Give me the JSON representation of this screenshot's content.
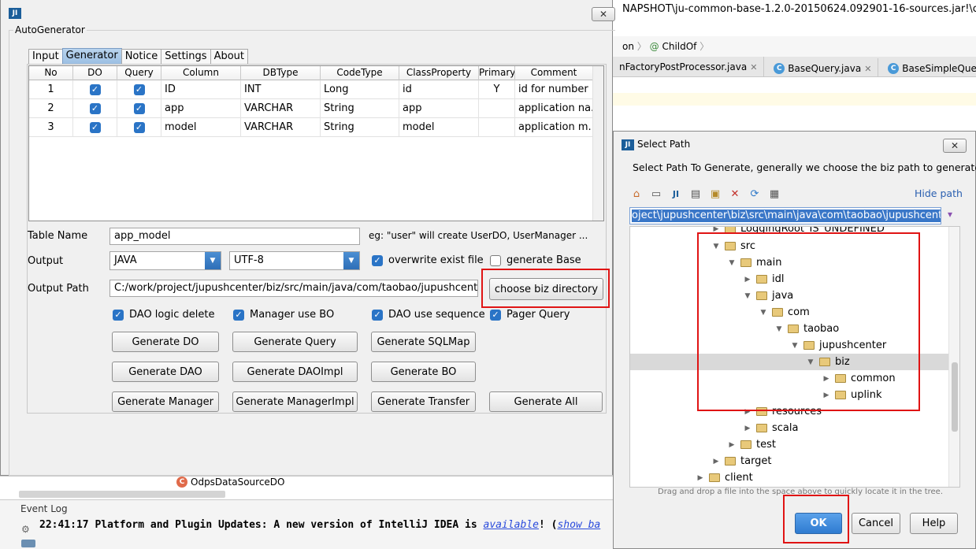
{
  "ide": {
    "title_path": "NAPSHOT\\ju-common-base-1.2.0-20150624.092901-16-sources.jar!\\com\\taobao",
    "breadcrumb": [
      "on",
      "ChildOf"
    ],
    "editor_tabs": [
      "nFactoryPostProcessor.java",
      "BaseQuery.java",
      "BaseSimpleQuery"
    ],
    "tree_item": "OdpsDataSourceDO",
    "event_log_title": "Event Log",
    "event_log_msg_prefix": "22:41:17 Platform and Plugin Updates: A new version of IntelliJ IDEA is ",
    "event_log_link": "available",
    "event_log_msg_suffix": "! (",
    "event_log_link2": "show ba"
  },
  "autogen": {
    "window_title_icon": "JI",
    "group_label": "AutoGenerator",
    "tabs": [
      "Input",
      "Generator",
      "Notice",
      "Settings",
      "About"
    ],
    "active_tab": "Generator",
    "columns": [
      "No",
      "DO",
      "Query",
      "Column",
      "DBType",
      "CodeType",
      "ClassProperty",
      "Primary",
      "Comment"
    ],
    "rows": [
      {
        "no": "1",
        "column": "ID",
        "dbtype": "INT",
        "codetype": "Long",
        "prop": "id",
        "primary": "Y",
        "comment": "id for number"
      },
      {
        "no": "2",
        "column": "app",
        "dbtype": "VARCHAR",
        "codetype": "String",
        "prop": "app",
        "primary": "",
        "comment": "application na..."
      },
      {
        "no": "3",
        "column": "model",
        "dbtype": "VARCHAR",
        "codetype": "String",
        "prop": "model",
        "primary": "",
        "comment": "application m..."
      }
    ],
    "table_name_label": "Table Name",
    "table_name_value": "app_model",
    "table_name_hint": "eg: \"user\" will create UserDO, UserManager ...",
    "output_label": "Output",
    "output_value": "JAVA",
    "encoding_value": "UTF-8",
    "overwrite_label": "overwrite exist file",
    "generate_base_label": "generate Base",
    "output_path_label": "Output Path",
    "output_path_value": "C:/work/project/jupushcenter/biz/src/main/java/com/taobao/jupushcenter/biz",
    "choose_biz_label": "choose biz directory",
    "options": [
      "DAO logic delete",
      "Manager use BO",
      "DAO use sequence",
      "Pager Query"
    ],
    "buttons": [
      "Generate DO",
      "Generate Query",
      "Generate SQLMap",
      "Generate DAO",
      "Generate DAOImpl",
      "Generate BO",
      "Generate Manager",
      "Generate ManagerImpl",
      "Generate Transfer",
      "Generate All"
    ],
    "close_glyph": "✕"
  },
  "select_path": {
    "title": "Select Path",
    "description": "Select Path To Generate, generally we choose the biz path to generate",
    "hide_path": "Hide path",
    "path_value": "oject\\jupushcenter\\biz\\src\\main\\java\\com\\taobao\\jupushcenter\\biz",
    "tree": [
      "LoggingRoot_IS_UNDEFINED",
      "src",
      "main",
      "idl",
      "java",
      "com",
      "taobao",
      "jupushcenter",
      "biz",
      "common",
      "uplink",
      "resources",
      "scala",
      "test",
      "target",
      "client"
    ],
    "drag_hint": "Drag and drop a file into the space above to quickly locate it in the tree.",
    "ok": "OK",
    "cancel": "Cancel",
    "help": "Help"
  },
  "colors": {
    "accent": "#2a74c6",
    "highlight_box": "#e01414",
    "selection": "#3a77c8"
  }
}
